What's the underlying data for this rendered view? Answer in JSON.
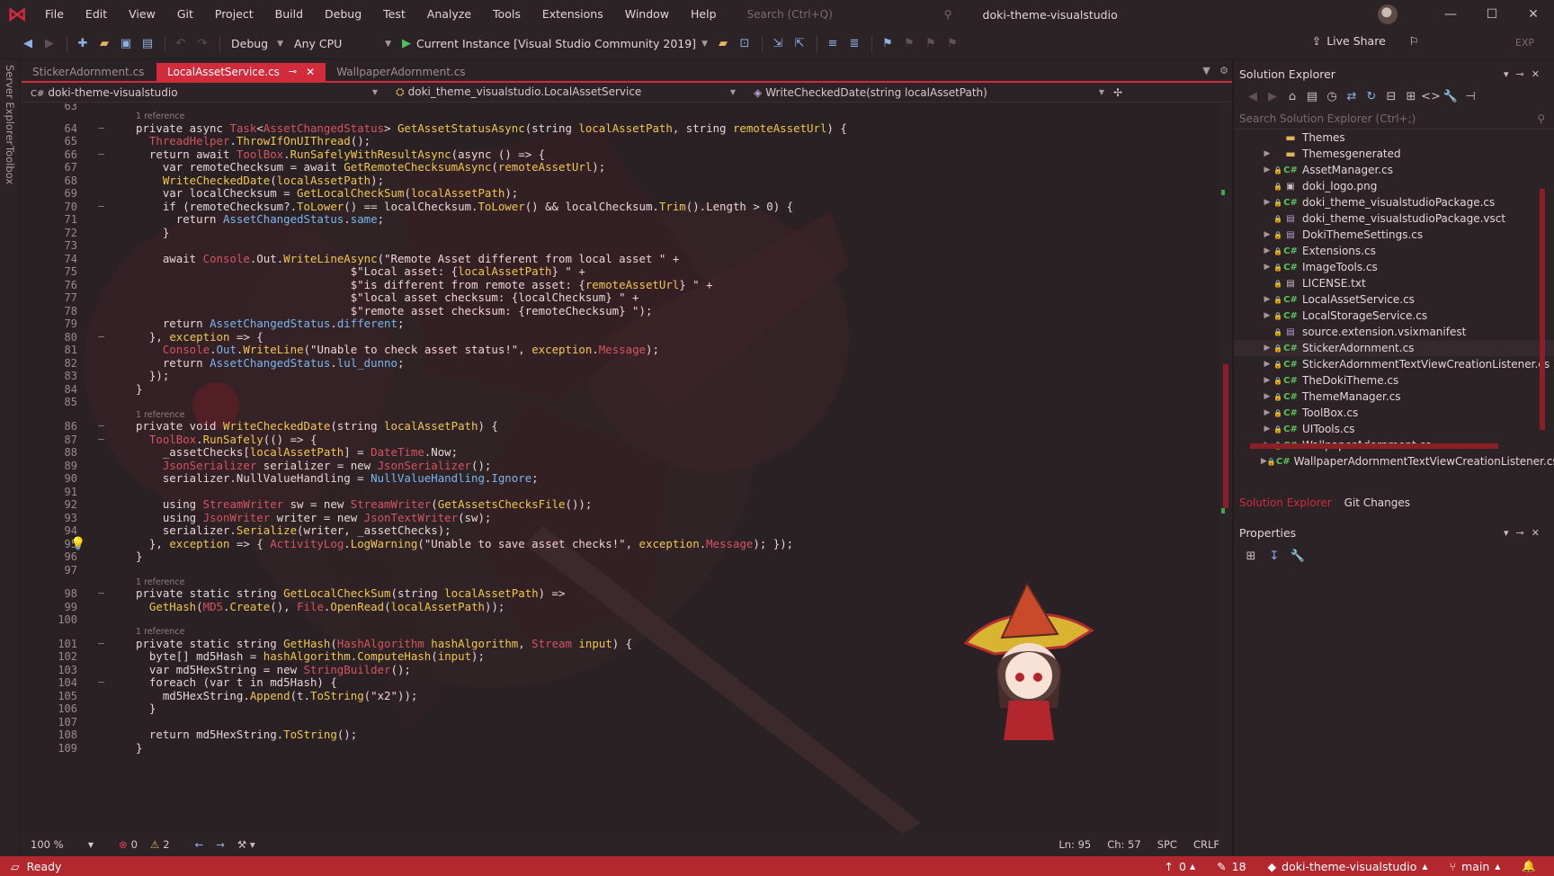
{
  "menubar": {
    "items": [
      "File",
      "Edit",
      "View",
      "Git",
      "Project",
      "Build",
      "Debug",
      "Test",
      "Analyze",
      "Tools",
      "Extensions",
      "Window",
      "Help"
    ],
    "search_placeholder": "Search (Ctrl+Q)",
    "solution_name": "doki-theme-visualstudio"
  },
  "toolbar": {
    "config": "Debug",
    "platform": "Any CPU",
    "run_target": "Current Instance [Visual Studio Community 2019]",
    "live_share": "Live Share",
    "exp": "EXP"
  },
  "left_rail": {
    "server_explorer": "Server Explorer",
    "toolbox": "Toolbox"
  },
  "tabs": [
    {
      "label": "StickerAdornment.cs"
    },
    {
      "label": "LocalAssetService.cs"
    },
    {
      "label": "WallpaperAdornment.cs"
    }
  ],
  "navbar": {
    "project": "doki-theme-visualstudio",
    "class": "doki_theme_visualstudio.LocalAssetService",
    "member": "WriteCheckedDate(string localAssetPath)"
  },
  "code": {
    "ref_label": "1 reference",
    "line_numbers": [
      "63",
      "64",
      "65",
      "66",
      "67",
      "68",
      "69",
      "70",
      "71",
      "72",
      "73",
      "74",
      "75",
      "76",
      "77",
      "78",
      "79",
      "80",
      "81",
      "82",
      "83",
      "84",
      "85",
      "86",
      "87",
      "88",
      "89",
      "90",
      "91",
      "92",
      "93",
      "94",
      "95",
      "96",
      "97",
      "98",
      "99",
      "100",
      "101",
      "102",
      "103",
      "104",
      "105",
      "106",
      "107",
      "108",
      "109"
    ]
  },
  "hintbar": {
    "zoom": "100 %",
    "errors": "0",
    "warnings": "2",
    "line": "Ln: 95",
    "col": "Ch: 57",
    "spc": "SPC",
    "crlf": "CRLF"
  },
  "status": {
    "ready": "Ready",
    "up": "0",
    "pencil": "18",
    "repo": "doki-theme-visualstudio",
    "branch": "main"
  },
  "solution_explorer": {
    "title": "Solution Explorer",
    "search_placeholder": "Search Solution Explorer (Ctrl+;)",
    "items": [
      {
        "label": "Themes",
        "icon": "folder-icon",
        "expandable": false
      },
      {
        "label": "Themesgenerated",
        "icon": "folder-icon",
        "expandable": true
      },
      {
        "label": "AssetManager.cs",
        "icon": "csharp-icon",
        "expandable": true
      },
      {
        "label": "doki_logo.png",
        "icon": "image-icon",
        "expandable": false
      },
      {
        "label": "doki_theme_visualstudioPackage.cs",
        "icon": "csharp-icon",
        "expandable": true
      },
      {
        "label": "doki_theme_visualstudioPackage.vsct",
        "icon": "vsct-icon",
        "expandable": false
      },
      {
        "label": "DokiThemeSettings.cs",
        "icon": "settings-file-icon",
        "expandable": true
      },
      {
        "label": "Extensions.cs",
        "icon": "csharp-icon",
        "expandable": true
      },
      {
        "label": "ImageTools.cs",
        "icon": "csharp-icon",
        "expandable": true
      },
      {
        "label": "LICENSE.txt",
        "icon": "text-file-icon",
        "expandable": false
      },
      {
        "label": "LocalAssetService.cs",
        "icon": "csharp-icon",
        "expandable": true
      },
      {
        "label": "LocalStorageService.cs",
        "icon": "csharp-icon",
        "expandable": true
      },
      {
        "label": "source.extension.vsixmanifest",
        "icon": "manifest-icon",
        "expandable": false
      },
      {
        "label": "StickerAdornment.cs",
        "icon": "csharp-icon",
        "expandable": true
      },
      {
        "label": "StickerAdornmentTextViewCreationListener.cs",
        "icon": "csharp-icon",
        "expandable": true
      },
      {
        "label": "TheDokiTheme.cs",
        "icon": "csharp-icon",
        "expandable": true
      },
      {
        "label": "ThemeManager.cs",
        "icon": "csharp-icon",
        "expandable": true
      },
      {
        "label": "ToolBox.cs",
        "icon": "csharp-icon",
        "expandable": true
      },
      {
        "label": "UITools.cs",
        "icon": "csharp-icon",
        "expandable": true
      },
      {
        "label": "WallpaperAdornment.cs",
        "icon": "csharp-icon",
        "expandable": true
      },
      {
        "label": "WallpaperAdornmentTextViewCreationListener.cs",
        "icon": "csharp-icon",
        "expandable": true
      }
    ],
    "tab_solution": "Solution Explorer",
    "tab_git": "Git Changes"
  },
  "properties": {
    "title": "Properties"
  },
  "colors": {
    "accent": "#d12b3c",
    "status_bar": "#b3272f",
    "keyword_type": "#d6545f",
    "method": "#f0c84f",
    "class_ref": "#77b7f0"
  }
}
